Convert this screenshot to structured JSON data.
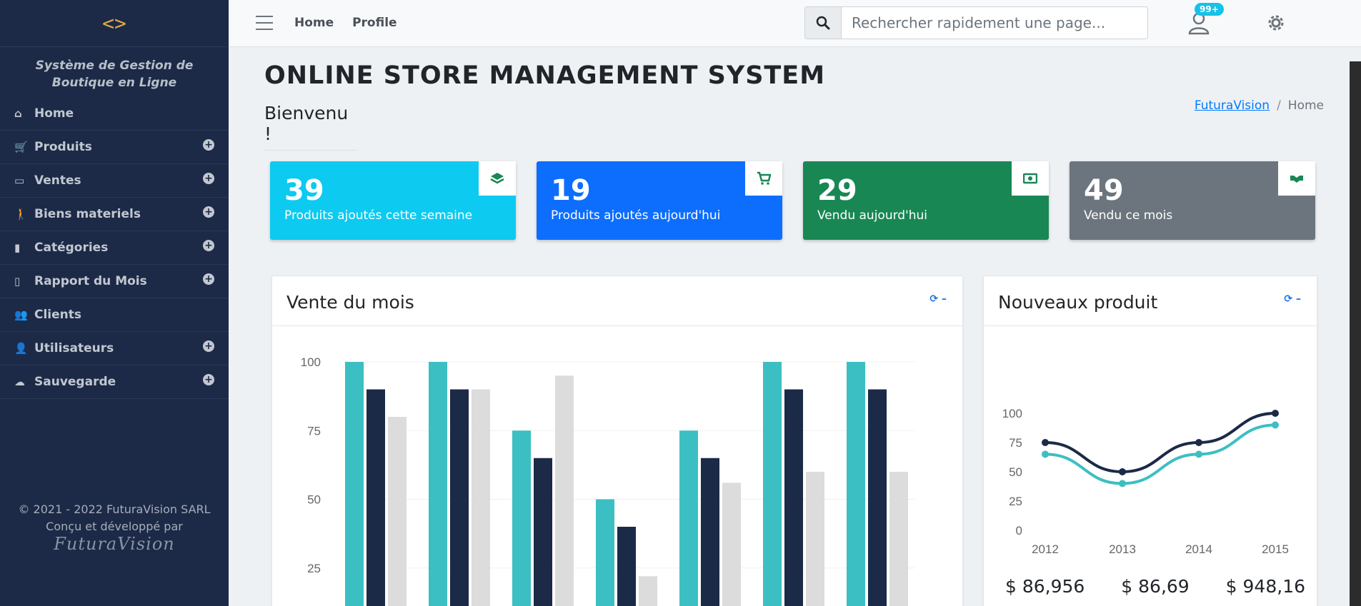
{
  "sidebar": {
    "brand": "<>",
    "system_name": "Système de Gestion de Boutique en Ligne",
    "items": [
      {
        "label": "Home",
        "icon": "home-icon",
        "expand": false
      },
      {
        "label": "Produits",
        "icon": "cart-icon",
        "expand": true
      },
      {
        "label": "Ventes",
        "icon": "money-icon",
        "expand": true
      },
      {
        "label": "Biens materiels",
        "icon": "walking-icon",
        "expand": true
      },
      {
        "label": "Catégories",
        "icon": "book-icon",
        "expand": true
      },
      {
        "label": "Rapport du Mois",
        "icon": "file-icon",
        "expand": true
      },
      {
        "label": "Clients",
        "icon": "users-icon",
        "expand": false
      },
      {
        "label": "Utilisateurs",
        "icon": "user-cog-icon",
        "expand": true
      },
      {
        "label": "Sauvegarde",
        "icon": "cloud-upload-icon",
        "expand": true
      }
    ],
    "footer_line1": "© 2021 - 2022 FuturaVision SARL",
    "footer_line2": "Conçu et développé par",
    "footer_logo": "FuturaVision"
  },
  "topbar": {
    "nav": [
      "Home",
      "Profile"
    ],
    "search_placeholder": "Rechercher rapidement une page...",
    "notification_badge": "99+"
  },
  "page": {
    "title": "ONLINE STORE MANAGEMENT SYSTEM",
    "welcome": "Bienvenu !",
    "breadcrumb_link": "FuturaVision",
    "breadcrumb_sep": "/",
    "breadcrumb_current": "Home"
  },
  "stats": [
    {
      "value": "39",
      "label": "Produits ajoutés cette semaine",
      "color": "#0dcaf0",
      "icon": "layers-icon"
    },
    {
      "value": "19",
      "label": "Produits ajoutés aujourd'hui",
      "color": "#0d6efd",
      "icon": "cart-plus-icon"
    },
    {
      "value": "29",
      "label": "Vendu aujourd'hui",
      "color": "#198754",
      "icon": "money-bill-icon"
    },
    {
      "value": "49",
      "label": "Vendu ce mois",
      "color": "#6c757d",
      "icon": "handshake-icon"
    }
  ],
  "cards": {
    "sales_title": "Vente du mois",
    "new_products_title": "Nouveaux produit",
    "tools": "⟳ –"
  },
  "chart_data": [
    {
      "type": "bar",
      "ylim": [
        0,
        100
      ],
      "yticks": [
        "25",
        "50",
        "75",
        "100"
      ],
      "series": [
        {
          "values": [
            100,
            100,
            75,
            50,
            75,
            100,
            100
          ],
          "color": "#3cbfc2"
        },
        {
          "values": [
            90,
            90,
            65,
            40,
            65,
            90,
            90
          ],
          "color": "#1b2a47"
        },
        {
          "values": [
            80,
            90,
            95,
            22,
            56,
            60,
            60
          ],
          "color": "#dcdcdc"
        }
      ]
    },
    {
      "type": "line",
      "x": [
        "2012",
        "2013",
        "2014",
        "2015"
      ],
      "ylim": [
        0,
        100
      ],
      "yticks": [
        "0",
        "25",
        "50",
        "75",
        "100"
      ],
      "series": [
        {
          "values": [
            75,
            50,
            75,
            100
          ],
          "color": "#1b2a47"
        },
        {
          "values": [
            65,
            40,
            65,
            90
          ],
          "color": "#3cbfc2"
        }
      ]
    }
  ],
  "amounts": [
    "$ 86,956",
    "$ 86,69",
    "$ 948,16"
  ]
}
